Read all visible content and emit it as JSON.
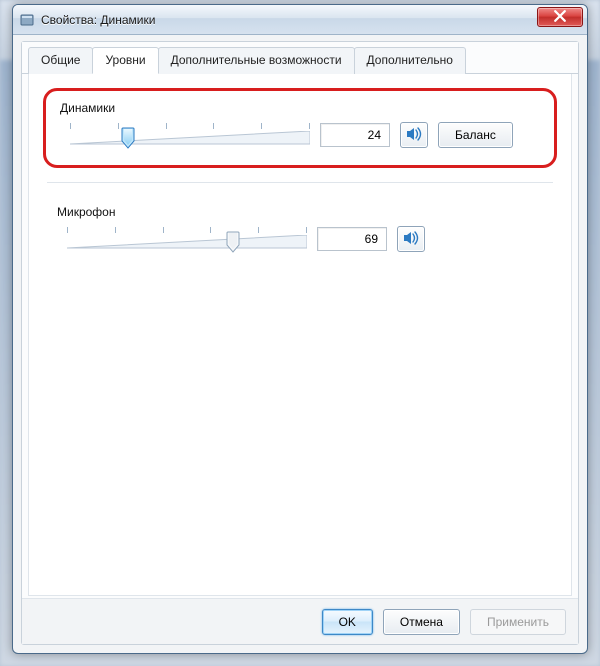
{
  "window": {
    "title": "Свойства: Динамики"
  },
  "tabs": {
    "general": "Общие",
    "levels": "Уровни",
    "enhancements": "Дополнительные возможности",
    "advanced": "Дополнительно",
    "active": "levels"
  },
  "speakers": {
    "label": "Динамики",
    "value": "24",
    "percent": 24,
    "balance_btn": "Баланс"
  },
  "microphone": {
    "label": "Микрофон",
    "value": "69",
    "percent": 69
  },
  "footer": {
    "ok": "OK",
    "cancel": "Отмена",
    "apply": "Применить"
  },
  "colors": {
    "highlight": "#d81e1e",
    "accent": "#2b7ac2"
  }
}
